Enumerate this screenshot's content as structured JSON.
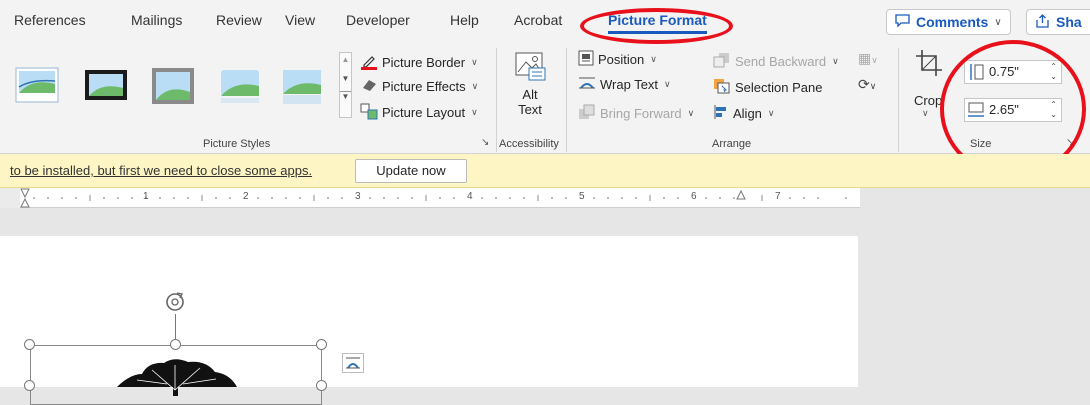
{
  "tabs": [
    {
      "label": "References"
    },
    {
      "label": "Mailings"
    },
    {
      "label": "Review"
    },
    {
      "label": "View"
    },
    {
      "label": "Developer"
    },
    {
      "label": "Help"
    },
    {
      "label": "Acrobat"
    },
    {
      "label": "Picture Format"
    }
  ],
  "header": {
    "comments_label": "Comments",
    "share_label": "Sha"
  },
  "ribbon": {
    "picture_styles": {
      "label": "Picture Styles",
      "border": "Picture Border",
      "effects": "Picture Effects",
      "layout": "Picture Layout"
    },
    "accessibility": {
      "label": "Accessibility",
      "alt_text_1": "Alt",
      "alt_text_2": "Text"
    },
    "arrange": {
      "label": "Arrange",
      "position": "Position",
      "wrap_text": "Wrap Text",
      "bring_forward": "Bring Forward",
      "send_backward": "Send Backward",
      "selection_pane": "Selection Pane",
      "align": "Align"
    },
    "size": {
      "label": "Size",
      "crop": "Crop",
      "height": "0.75\"",
      "width": "2.65\""
    }
  },
  "notification": {
    "text": "to be installed, but first we need to close some apps.",
    "button": "Update now"
  },
  "ruler": {
    "numbers": [
      "1",
      "2",
      "3",
      "4",
      "5",
      "6",
      "7"
    ]
  },
  "colors": {
    "accent": "#185abd",
    "highlight": "#e8101a",
    "notification_bg": "#fdf6c4"
  }
}
